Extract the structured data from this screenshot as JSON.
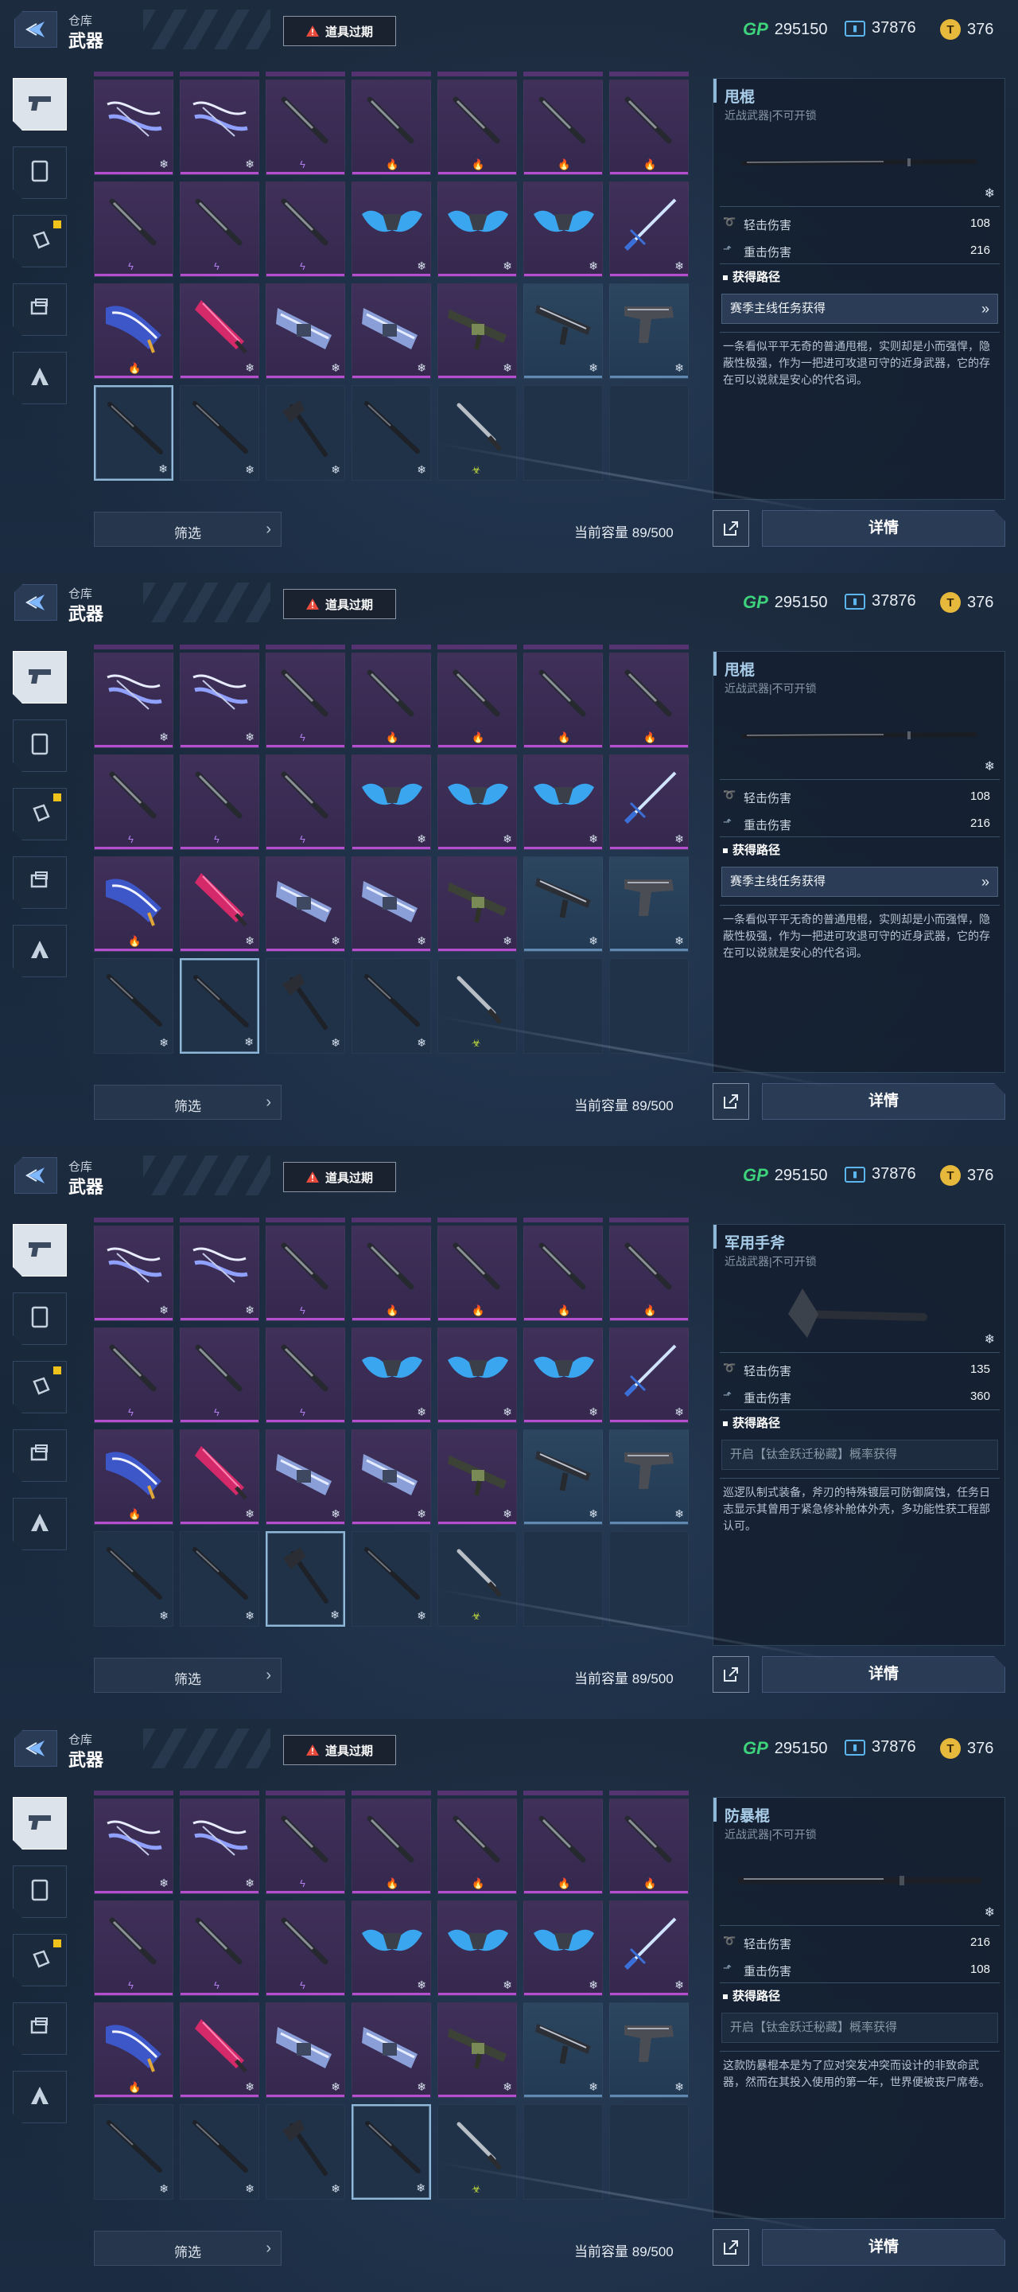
{
  "header": {
    "crumb_small": "仓库",
    "crumb_title": "武器",
    "alert_label": "道具过期",
    "currency": [
      {
        "icon": "gp-icon",
        "label": "GP",
        "value": "295150"
      },
      {
        "icon": "ticket-icon",
        "value": "37876"
      },
      {
        "icon": "coin-icon",
        "value": "376"
      }
    ]
  },
  "categories": [
    {
      "name": "pistol-tab-icon",
      "active": true
    },
    {
      "name": "card-tab-icon",
      "active": false
    },
    {
      "name": "grenade-tab-icon",
      "active": false,
      "badge": true
    },
    {
      "name": "module-tab-icon",
      "active": false
    },
    {
      "name": "character-tab-icon",
      "active": false
    }
  ],
  "grid": {
    "rows": [
      [
        {
          "rarity": "purple",
          "weapon": "bow",
          "element": "frost"
        },
        {
          "rarity": "purple",
          "weapon": "bow",
          "element": "frost"
        },
        {
          "rarity": "purple",
          "weapon": "knife",
          "element": "lightning"
        },
        {
          "rarity": "purple",
          "weapon": "knife",
          "element": "fire"
        },
        {
          "rarity": "purple",
          "weapon": "knife",
          "element": "fire"
        },
        {
          "rarity": "purple",
          "weapon": "knife",
          "element": "fire"
        },
        {
          "rarity": "purple",
          "weapon": "knife",
          "element": "fire"
        }
      ],
      [
        {
          "rarity": "purple",
          "weapon": "knife",
          "element": "lightning"
        },
        {
          "rarity": "purple",
          "weapon": "knife",
          "element": "lightning"
        },
        {
          "rarity": "purple",
          "weapon": "knife",
          "element": "lightning"
        },
        {
          "rarity": "purple",
          "weapon": "wings",
          "element": "frost"
        },
        {
          "rarity": "purple",
          "weapon": "wings",
          "element": "frost"
        },
        {
          "rarity": "purple",
          "weapon": "wings",
          "element": "frost"
        },
        {
          "rarity": "purple",
          "weapon": "sword",
          "element": "frost"
        }
      ],
      [
        {
          "rarity": "purple",
          "weapon": "gauntlet",
          "element": "fire"
        },
        {
          "rarity": "purple",
          "weapon": "crystal",
          "element": "frost"
        },
        {
          "rarity": "purple",
          "weapon": "cannon",
          "element": "frost"
        },
        {
          "rarity": "purple",
          "weapon": "cannon",
          "element": "frost"
        },
        {
          "rarity": "purple",
          "weapon": "rifle",
          "element": "frost"
        },
        {
          "rarity": "blue",
          "weapon": "smg",
          "element": "frost"
        },
        {
          "rarity": "blue",
          "weapon": "pistol",
          "element": "frost"
        }
      ],
      [
        {
          "rarity": "empty",
          "weapon": "baton",
          "element": "frost"
        },
        {
          "rarity": "empty",
          "weapon": "baton",
          "element": "frost"
        },
        {
          "rarity": "empty",
          "weapon": "axe",
          "element": "frost"
        },
        {
          "rarity": "empty",
          "weapon": "baton",
          "element": "frost"
        },
        {
          "rarity": "empty",
          "weapon": "dagger",
          "element": "poison"
        },
        {
          "rarity": "empty",
          "weapon": "none"
        },
        {
          "rarity": "empty",
          "weapon": "none"
        }
      ]
    ]
  },
  "footer": {
    "filter_label": "筛选",
    "capacity_label": "当前容量",
    "capacity_value": "89/500",
    "detail_button": "详情"
  },
  "common": {
    "light_label": "轻击伤害",
    "heavy_label": "重击伤害",
    "path_title": "获得路径"
  },
  "panels": [
    {
      "selected": [
        3,
        0
      ],
      "item": {
        "name": "甩棍",
        "subtitle": "近战武器|不可开锁",
        "picture": "baton",
        "light_value": "108",
        "heavy_value": "216",
        "source": "赛季主线任务获得",
        "source_active": true,
        "description": "一条看似平平无奇的普通甩棍，实则却是小而强悍，隐蔽性极强，作为一把进可攻退可守的近身武器，它的存在可以说就是安心的代名词。"
      }
    },
    {
      "selected": [
        3,
        1
      ],
      "item": {
        "name": "甩棍",
        "subtitle": "近战武器|不可开锁",
        "picture": "baton",
        "light_value": "108",
        "heavy_value": "216",
        "source": "赛季主线任务获得",
        "source_active": true,
        "description": "一条看似平平无奇的普通甩棍，实则却是小而强悍，隐蔽性极强，作为一把进可攻退可守的近身武器，它的存在可以说就是安心的代名词。"
      }
    },
    {
      "selected": [
        3,
        2
      ],
      "item": {
        "name": "军用手斧",
        "subtitle": "近战武器|不可开锁",
        "picture": "axe",
        "light_value": "135",
        "heavy_value": "360",
        "source": "开启【钛金跃迁秘藏】概率获得",
        "source_active": false,
        "description": "巡逻队制式装备，斧刃的特殊镀层可防御腐蚀，任务日志显示其曾用于紧急修补舱体外壳，多功能性获工程部认可。"
      }
    },
    {
      "selected": [
        3,
        3
      ],
      "item": {
        "name": "防暴棍",
        "subtitle": "近战武器|不可开锁",
        "picture": "riot-baton",
        "light_value": "216",
        "heavy_value": "108",
        "source": "开启【钛金跃迁秘藏】概率获得",
        "source_active": false,
        "description": "这款防暴棍本是为了应对突发冲突而设计的非致命武器，然而在其投入使用的第一年，世界便被丧尸席卷。"
      }
    }
  ]
}
